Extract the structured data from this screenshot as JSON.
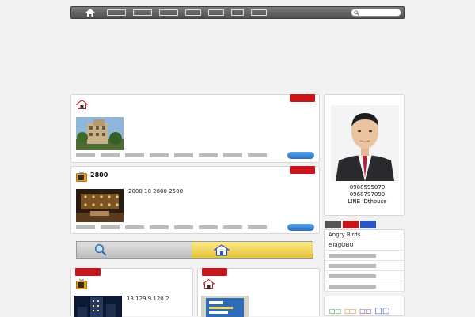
{
  "nav": {
    "items": [
      {
        "label": "",
        "w": 22
      },
      {
        "label": "",
        "w": 22
      },
      {
        "label": "",
        "w": 22
      },
      {
        "label": "",
        "w": 18
      },
      {
        "label": "",
        "w": 18
      },
      {
        "label": "",
        "w": 14
      },
      {
        "label": "",
        "w": 18
      }
    ],
    "search_placeholder": ""
  },
  "listing1": {
    "title": "",
    "meta": "",
    "badge": "",
    "description": "",
    "tags": [
      "",
      "",
      "",
      "",
      "",
      "",
      "",
      "",
      "",
      "",
      "",
      ""
    ],
    "more": ""
  },
  "listing2": {
    "title": "2800",
    "meta": "",
    "badge": "",
    "description": "2000 10 2800 2500",
    "tags": [
      "",
      "",
      "",
      "",
      "",
      "",
      "",
      "",
      "",
      "",
      "",
      ""
    ],
    "more": ""
  },
  "banner": {
    "rent_label": "",
    "buy_label": ""
  },
  "listing3": {
    "badge": "",
    "title": "",
    "meta": "",
    "description": "13 129.9 120.2"
  },
  "listing4": {
    "badge": "",
    "title": "",
    "meta": "",
    "description": ""
  },
  "agent": {
    "header": "",
    "name_line": "",
    "phone1": "0988595070",
    "phone2": "0968797090",
    "line_id": "LINE IDthouse"
  },
  "sidebar": {
    "tabs": [
      {
        "label": "",
        "color": "#555555"
      },
      {
        "label": "",
        "color": "#c8161d"
      },
      {
        "label": "",
        "color": "#2a56c4"
      }
    ],
    "news": [
      "Angry Birds",
      "eTagOBU",
      "",
      "",
      "",
      ""
    ],
    "tagcloud_header": "",
    "tagcloud": [
      "",
      "",
      "",
      ""
    ]
  },
  "colors": {
    "accent_red": "#c8161d",
    "button_blue": "#2a6fc0"
  }
}
